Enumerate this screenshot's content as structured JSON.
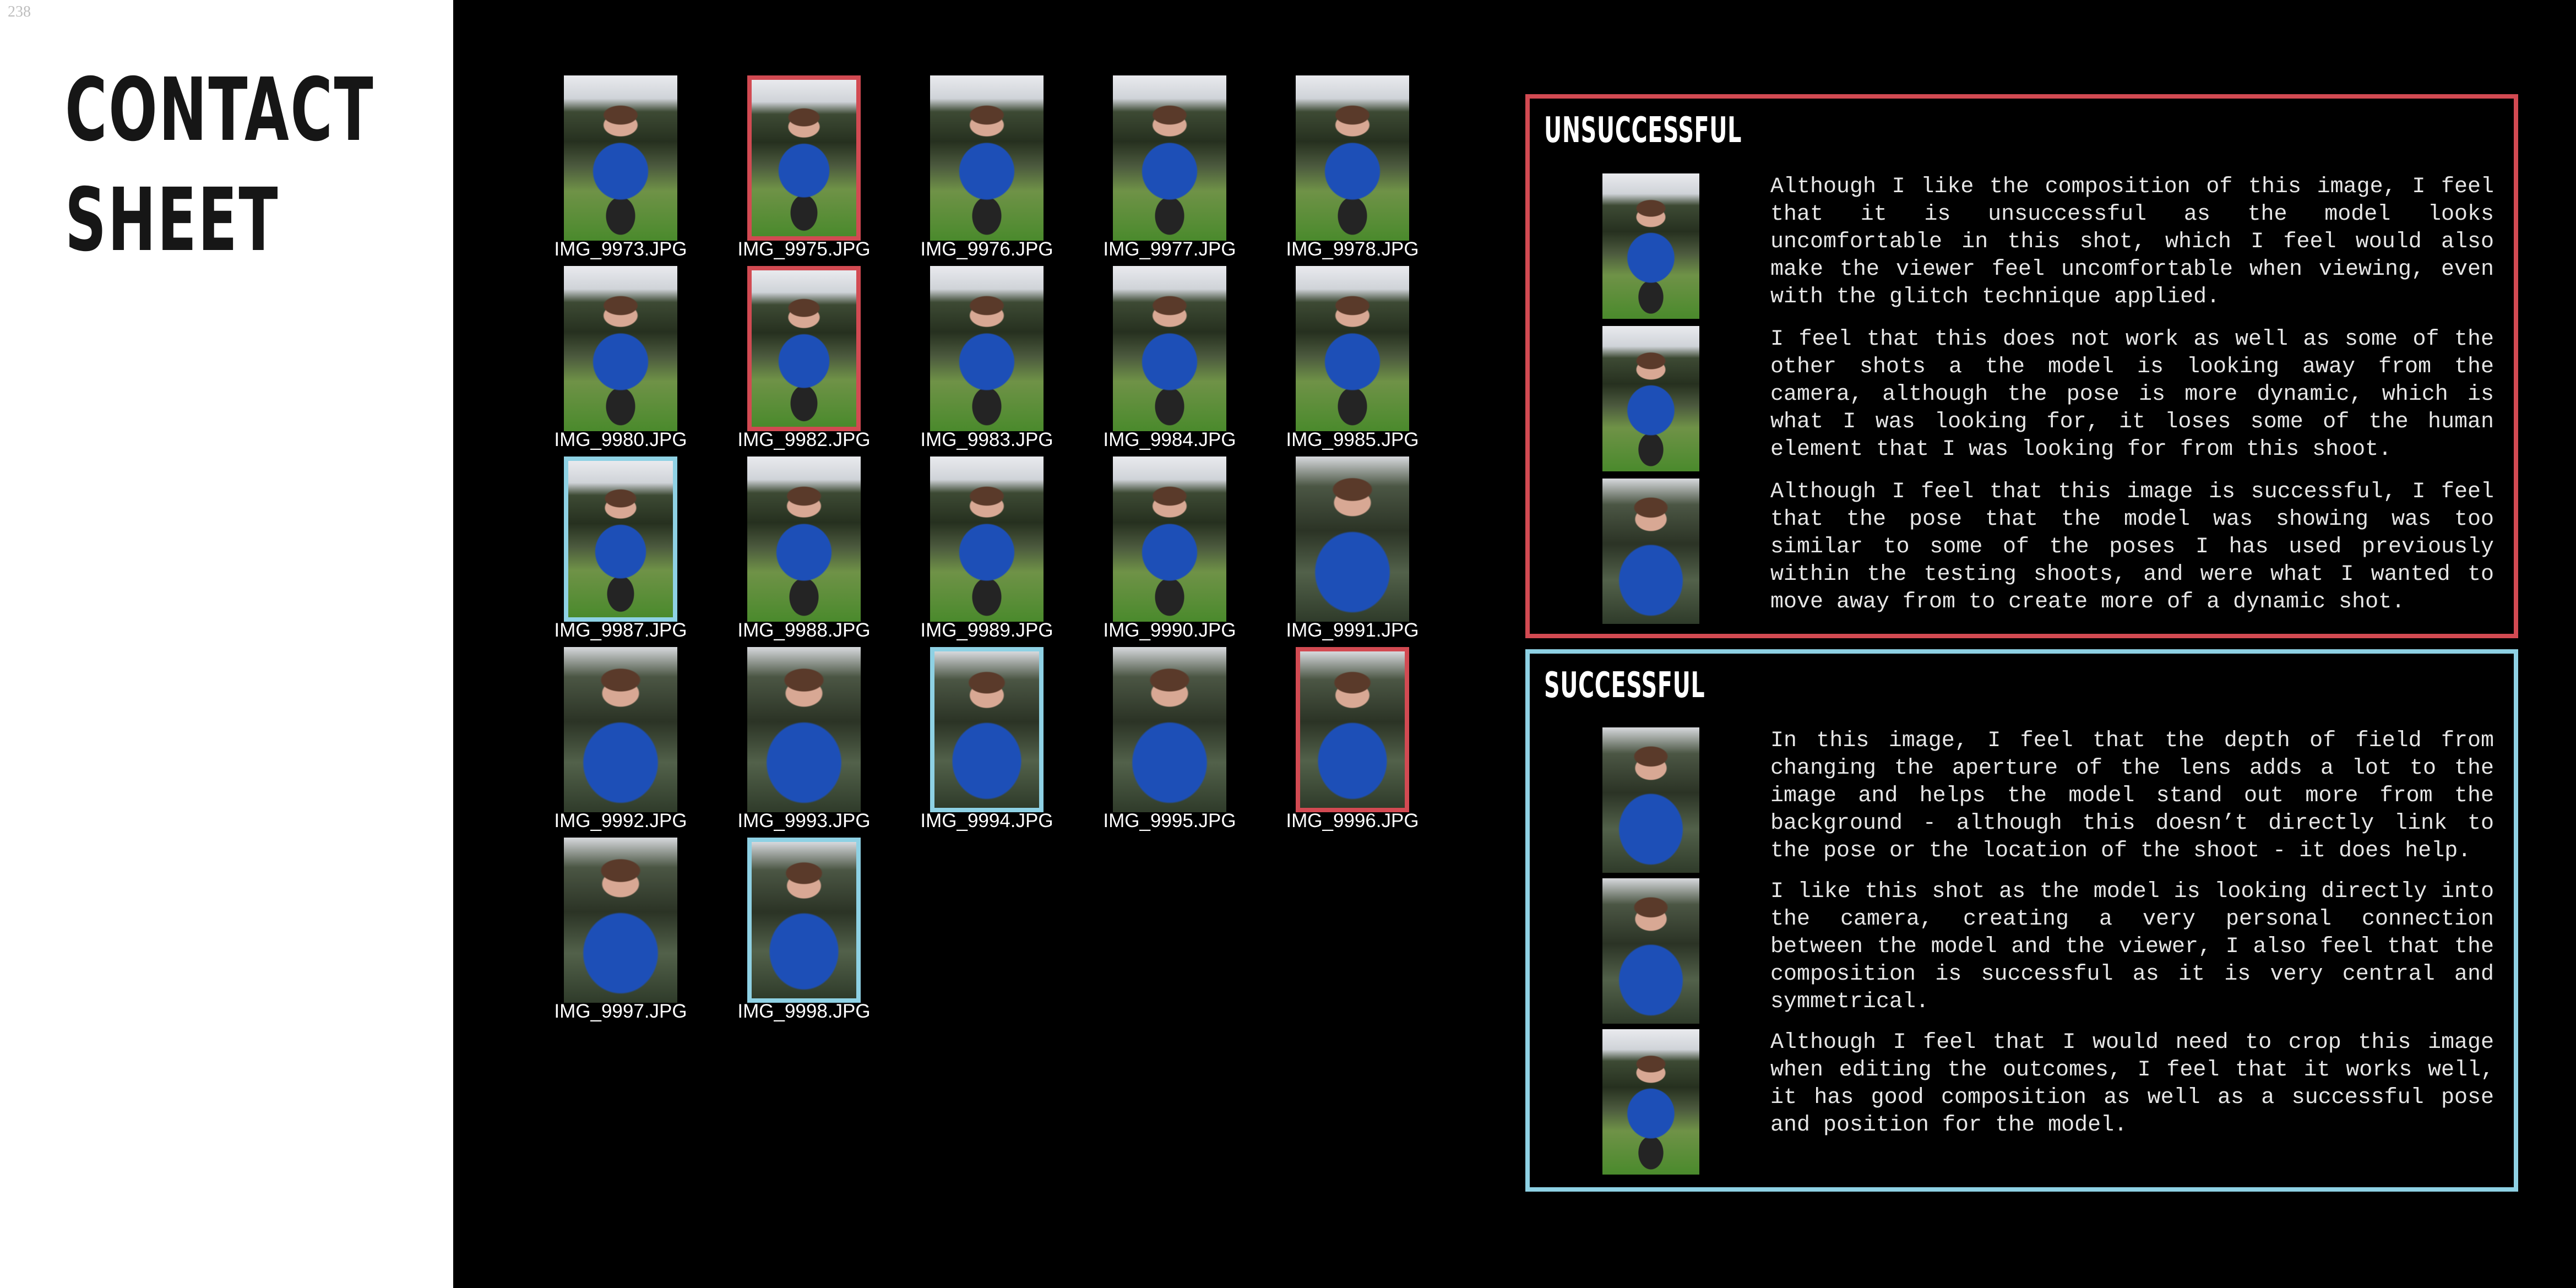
{
  "page_number": "238",
  "title": [
    "CONTACT",
    "SHEET"
  ],
  "contact_sheet": {
    "rows": [
      [
        {
          "filename": "IMG_9973.JPG",
          "marked": "none"
        },
        {
          "filename": "IMG_9975.JPG",
          "marked": "red"
        },
        {
          "filename": "IMG_9976.JPG",
          "marked": "none"
        },
        {
          "filename": "IMG_9977.JPG",
          "marked": "none"
        },
        {
          "filename": "IMG_9978.JPG",
          "marked": "none"
        }
      ],
      [
        {
          "filename": "IMG_9980.JPG",
          "marked": "none"
        },
        {
          "filename": "IMG_9982.JPG",
          "marked": "red"
        },
        {
          "filename": "IMG_9983.JPG",
          "marked": "none"
        },
        {
          "filename": "IMG_9984.JPG",
          "marked": "none"
        },
        {
          "filename": "IMG_9985.JPG",
          "marked": "none"
        }
      ],
      [
        {
          "filename": "IMG_9987.JPG",
          "marked": "blue"
        },
        {
          "filename": "IMG_9988.JPG",
          "marked": "none"
        },
        {
          "filename": "IMG_9989.JPG",
          "marked": "none"
        },
        {
          "filename": "IMG_9990.JPG",
          "marked": "none"
        },
        {
          "filename": "IMG_9991.JPG",
          "marked": "none"
        }
      ],
      [
        {
          "filename": "IMG_9992.JPG",
          "marked": "none"
        },
        {
          "filename": "IMG_9993.JPG",
          "marked": "none"
        },
        {
          "filename": "IMG_9994.JPG",
          "marked": "blue"
        },
        {
          "filename": "IMG_9995.JPG",
          "marked": "none"
        },
        {
          "filename": "IMG_9996.JPG",
          "marked": "red"
        }
      ],
      [
        {
          "filename": "IMG_9997.JPG",
          "marked": "none"
        },
        {
          "filename": "IMG_9998.JPG",
          "marked": "blue"
        }
      ]
    ]
  },
  "colors": {
    "unsuccessful": "#d24a52",
    "successful": "#8ed1e4",
    "background": "#000000"
  },
  "panels": {
    "unsuccessful": {
      "heading": "UNSUCCESSFUL",
      "entries": [
        "Although I like the composition of this image, I feel that it is unsuccessful as the model looks uncomfortable in this shot, which I feel would also make the viewer feel uncomfortable when viewing, even with the glitch technique applied.",
        "I feel that this does not work as well as some of the other shots a the model is looking away from the camera, although the pose is more dynamic, which is what I was looking for, it loses some of the human element that I was looking for from this shoot.",
        "Although I feel that this image is successful, I feel that the pose that the model was showing was too similar to some of the poses I has used previously within the testing shoots, and were what I wanted to move away from to create more of a dynamic shot."
      ]
    },
    "successful": {
      "heading": "SUCCESSFUL",
      "entries": [
        "In this image, I feel that the depth of field from changing the aperture of the lens adds a lot to the image and helps the model stand out more from the background - although this doesn’t directly link to the pose or the location of the shoot - it does help.",
        "I like this shot as the model is looking directly into the camera, creating a very personal connection between the model and the viewer, I also feel that the composition is successful as it is very central and symmetrical.",
        "Although I feel that I would need to crop this image when editing the outcomes, I feel that it works well, it has good composition as well as a successful pose and position for the model."
      ]
    }
  }
}
